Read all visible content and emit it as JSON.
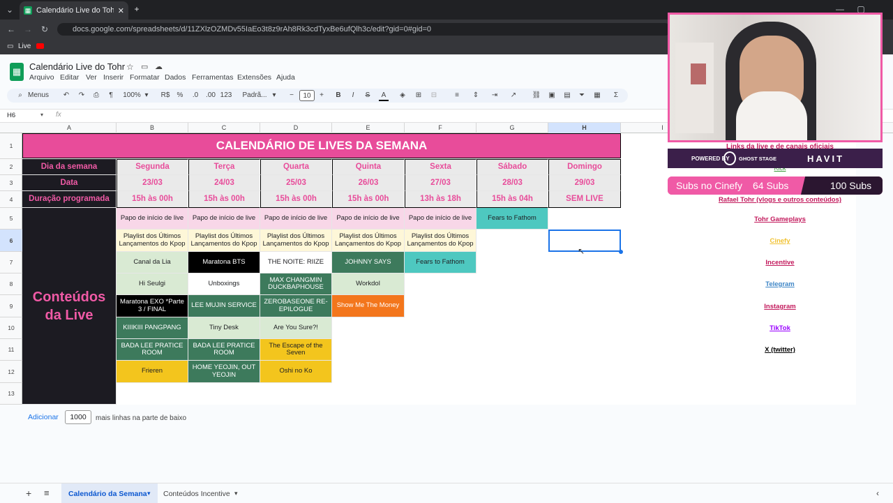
{
  "browser": {
    "tab_title": "Calendário Live do Tohr - Goog",
    "url": "docs.google.com/spreadsheets/d/11ZXlzOZMDv55IaEo3t8z9rAh8Rk3cdTyxBe6ufQlh3c/edit?gid=0#gid=0",
    "bookmark": "Live"
  },
  "doc": {
    "title": "Calendário Live do Tohr",
    "menus": [
      "Arquivo",
      "Editar",
      "Ver",
      "Inserir",
      "Formatar",
      "Dados",
      "Ferramentas",
      "Extensões",
      "Ajuda"
    ]
  },
  "toolbar": {
    "menus_label": "Menus",
    "zoom": "100%",
    "currency": "R$",
    "percent": "%",
    "dec_less": ".0",
    "dec_more": ".00",
    "number_fmt": "123",
    "font": "Padrã...",
    "font_size": "10"
  },
  "formula_bar": {
    "name_box": "H6",
    "fx": "fx"
  },
  "columns": [
    "A",
    "B",
    "C",
    "D",
    "E",
    "F",
    "G",
    "H",
    "I"
  ],
  "rows": [
    "1",
    "2",
    "3",
    "4",
    "5",
    "6",
    "7",
    "8",
    "9",
    "10",
    "11",
    "12",
    "13"
  ],
  "sheet": {
    "title": "CALENDÁRIO DE LIVES DA SEMANA",
    "row_labels": [
      "Dia da semana",
      "Data",
      "Duração programada"
    ],
    "days": [
      "Segunda",
      "Terça",
      "Quarta",
      "Quinta",
      "Sexta",
      "Sábado",
      "Domingo"
    ],
    "dates": [
      "23/03",
      "24/03",
      "25/03",
      "26/03",
      "27/03",
      "28/03",
      "29/03"
    ],
    "durations": [
      "15h às 00h",
      "15h às 00h",
      "15h às 00h",
      "15h às 00h",
      "13h às 18h",
      "15h às 04h",
      "SEM LIVE"
    ],
    "content_label": "Conteúdos da Live",
    "content": {
      "r5": [
        "Papo de início de live",
        "Papo de início de live",
        "Papo de início de live",
        "Papo de início de live",
        "Papo de início de live",
        "Fears to Fathom"
      ],
      "r6": [
        "Playlist dos Últimos Lançamentos do Kpop",
        "Playlist dos Últimos Lançamentos do Kpop",
        "Playlist dos Últimos Lançamentos do Kpop",
        "Playlist dos Últimos Lançamentos do Kpop",
        "Playlist dos Últimos Lançamentos do Kpop"
      ],
      "r7": [
        "Canal da Lia",
        "Maratona BTS",
        "THE NOITE: RIIZE",
        "JOHNNY SAYS",
        "Fears to Fathom"
      ],
      "r8": [
        "Hi Seulgi",
        "Unboxings",
        "MAX CHANGMIN DUCKBAPHOUSE",
        "Workdol"
      ],
      "r9": [
        "Maratona EXO *Parte 3 / FINAL",
        "LEE MUJIN SERVICE",
        "ZEROBASEONE RE-EPILOGUE",
        "Show Me The Money"
      ],
      "r10": [
        "KIIIKIII PANGPANG",
        "Tiny Desk",
        "Are You Sure?!"
      ],
      "r11": [
        "BADA LEE PRATICE ROOM",
        "BADA LEE PRATICE ROOM",
        "The Escape of the Seven"
      ],
      "r12": [
        "Frieren",
        "HOME YEOJIN, OUT YEOJIN",
        "Oshi no Ko"
      ]
    },
    "links_title": "Links da live e de canais oficiais",
    "links": [
      {
        "label": "Rafael Tohr (vlogs e outros conteúdos)",
        "color": "#c2185b"
      },
      {
        "label": "Tohr Gameplays",
        "color": "#c2185b"
      },
      {
        "label": "Cinefy",
        "color": "#f1c232"
      },
      {
        "label": "Incentive",
        "color": "#c2185b"
      },
      {
        "label": "Telegram",
        "color": "#3d85c6"
      },
      {
        "label": "Instagram",
        "color": "#c2185b"
      },
      {
        "label": "TikTok",
        "color": "#9900ff"
      },
      {
        "label": "X (twitter)",
        "color": "#000000"
      }
    ],
    "kick_label": "Kick"
  },
  "overlay": {
    "powered_by": "POWERED BY",
    "brand1": "GHOST STAGE",
    "brand2": "HAVIT",
    "subs_label": "Subs no Cinefy",
    "subs_count": "64 Subs",
    "subs_goal": "100 Subs",
    "subs_progress": 0.64
  },
  "add_rows": {
    "button": "Adicionar",
    "count": "1000",
    "suffix": "mais linhas na parte de baixo"
  },
  "sheet_tabs": [
    "Calendário da Semana",
    "Conteúdos Incentive"
  ],
  "colors": {
    "accent_pink": "#f05aa6",
    "header_pink": "#e84c9a",
    "sheets_green": "#0f9d58"
  }
}
